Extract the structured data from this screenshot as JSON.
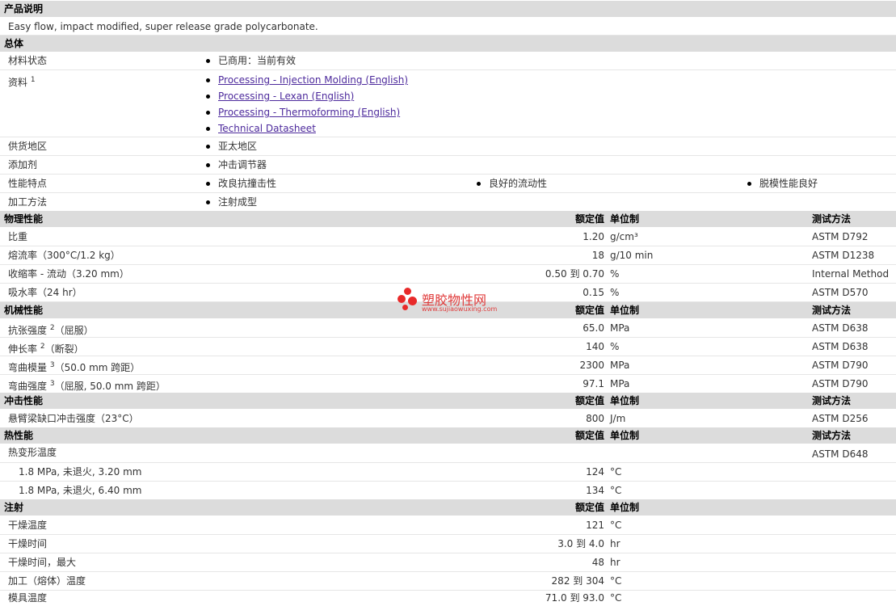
{
  "desc": {
    "title": "产品说明",
    "text": "Easy flow, impact modified, super release grade polycarbonate."
  },
  "general": {
    "title": "总体",
    "material_status": {
      "label": "材料状态",
      "value": "已商用：当前有效"
    },
    "docs": {
      "label": "资料",
      "sup": "1",
      "links": [
        "Processing - Injection Molding (English)",
        "Processing - Lexan (English)",
        "Processing - Thermoforming (English)",
        "Technical Datasheet"
      ]
    },
    "region": {
      "label": "供货地区",
      "value": "亚太地区"
    },
    "additive": {
      "label": "添加剂",
      "value": "冲击调节器"
    },
    "features": {
      "label": "性能特点",
      "values": [
        "改良抗撞击性",
        "良好的流动性",
        "脱模性能良好"
      ]
    },
    "processing": {
      "label": "加工方法",
      "value": "注射成型"
    }
  },
  "cols": {
    "nominal": "额定值",
    "unit": "单位制",
    "method": "测试方法"
  },
  "physical": {
    "title": "物理性能",
    "rows": [
      {
        "label": "比重",
        "value": "1.20",
        "unit": "g/cm³",
        "method": "ASTM D792"
      },
      {
        "label": "熔流率（300°C/1.2 kg）",
        "value": "18",
        "unit": "g/10 min",
        "method": "ASTM D1238"
      },
      {
        "label": "收缩率 - 流动（3.20 mm）",
        "value": "0.50 到  0.70",
        "unit": "%",
        "method": "Internal Method"
      },
      {
        "label": "吸水率（24 hr）",
        "value": "0.15",
        "unit": "%",
        "method": "ASTM D570"
      }
    ]
  },
  "mechanical": {
    "title": "机械性能",
    "rows": [
      {
        "label": "抗张强度",
        "sup": "2",
        "suffix": "（屈服）",
        "value": "65.0",
        "unit": "MPa",
        "method": "ASTM D638"
      },
      {
        "label": "伸长率",
        "sup": "2",
        "suffix": "（断裂）",
        "value": "140",
        "unit": "%",
        "method": "ASTM D638"
      },
      {
        "label": "弯曲模量",
        "sup": "3",
        "suffix": "（50.0 mm 跨距）",
        "value": "2300",
        "unit": "MPa",
        "method": "ASTM D790"
      },
      {
        "label": "弯曲强度",
        "sup": "3",
        "suffix": "（屈服, 50.0 mm 跨距）",
        "value": "97.1",
        "unit": "MPa",
        "method": "ASTM D790"
      }
    ]
  },
  "impact": {
    "title": "冲击性能",
    "rows": [
      {
        "label": "悬臂梁缺口冲击强度（23°C）",
        "value": "800",
        "unit": "J/m",
        "method": "ASTM D256"
      }
    ]
  },
  "thermal": {
    "title": "热性能",
    "rows": [
      {
        "label": "热变形温度",
        "value": "",
        "unit": "",
        "method": "ASTM D648"
      },
      {
        "label": "1.8 MPa, 未退火, 3.20 mm",
        "value": "124",
        "unit": "°C",
        "method": ""
      },
      {
        "label": "1.8 MPa, 未退火, 6.40 mm",
        "value": "134",
        "unit": "°C",
        "method": ""
      }
    ]
  },
  "injection": {
    "title": "注射",
    "rows": [
      {
        "label": "干燥温度",
        "value": "121",
        "unit": "°C"
      },
      {
        "label": "干燥时间",
        "value": "3.0 到  4.0",
        "unit": "hr"
      },
      {
        "label": "干燥时间，最大",
        "value": "48",
        "unit": "hr"
      },
      {
        "label": "加工（熔体）温度",
        "value": "282 到  304",
        "unit": "°C"
      },
      {
        "label": "模具温度",
        "value": "71.0 到  93.0",
        "unit": "°C"
      }
    ]
  },
  "watermark": {
    "text": "塑胶物性网",
    "url": "www.sujiaowuxing.com"
  }
}
